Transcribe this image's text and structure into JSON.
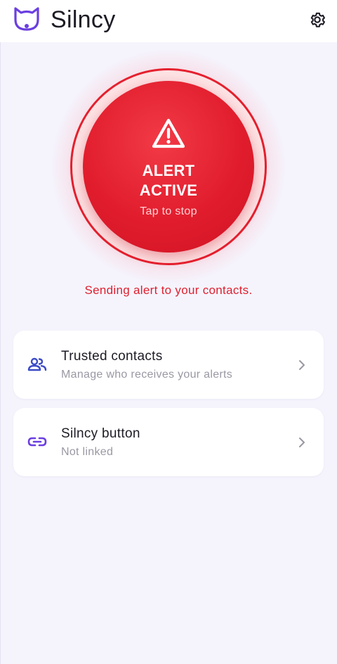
{
  "header": {
    "app_title": "Silncy",
    "logo_icon": "cat-logo-icon",
    "settings_icon": "gear-icon"
  },
  "alert": {
    "title_line1": "ALERT",
    "title_line2": "ACTIVE",
    "subtitle": "Tap to stop",
    "icon": "warning-icon",
    "state": "active"
  },
  "status": {
    "text": "Sending alert to your contacts."
  },
  "cards": [
    {
      "title": "Trusted contacts",
      "subtitle": "Manage who receives your alerts",
      "icon": "people-icon"
    },
    {
      "title": "Silncy button",
      "subtitle": "Not linked",
      "icon": "link-icon"
    }
  ],
  "colors": {
    "brand": "#6b3fe0",
    "alert_red": "#e11d2d",
    "background": "#f5f4fd",
    "contacts_icon": "#3b4bc7",
    "link_icon": "#6b3fe0"
  }
}
